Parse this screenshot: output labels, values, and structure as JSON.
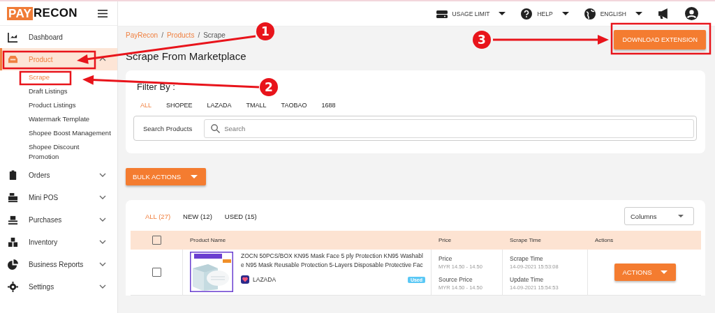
{
  "logo": {
    "part_1": "PAY",
    "part_2": "RECON"
  },
  "sidebar": {
    "items": [
      {
        "label": "Dashboard",
        "selected": false
      },
      {
        "label": "Product",
        "selected": true,
        "expanded": true,
        "children": [
          {
            "label": "Scrape",
            "selected": true
          },
          {
            "label": "Draft Listings",
            "selected": false
          },
          {
            "label": "Product Listings",
            "selected": false
          },
          {
            "label": "Watermark Template",
            "selected": false
          },
          {
            "label": "Shopee Boost Management",
            "selected": false
          },
          {
            "label": "Shopee Discount Promotion",
            "selected": false
          }
        ]
      },
      {
        "label": "Orders",
        "selected": false,
        "expanded": false
      },
      {
        "label": "Mini POS",
        "selected": false,
        "expanded": false
      },
      {
        "label": "Purchases",
        "selected": false,
        "expanded": false
      },
      {
        "label": "Inventory",
        "selected": false,
        "expanded": false
      },
      {
        "label": "Business Reports",
        "selected": false,
        "expanded": false
      },
      {
        "label": "Settings",
        "selected": false,
        "expanded": false
      }
    ]
  },
  "top_bar": {
    "menus": [
      {
        "label": "USAGE LIMIT"
      },
      {
        "label": "HELP"
      },
      {
        "label": "ENGLISH"
      }
    ]
  },
  "breadcrumb": {
    "separator": "/",
    "items": [
      "PayRecon",
      "Products",
      "Scrape"
    ]
  },
  "page_title": "Scrape From Marketplace",
  "download_button": "DOWNLOAD EXTENSION",
  "filter": {
    "title": "Filter By :",
    "tabs": [
      {
        "label": "ALL",
        "selected": true
      },
      {
        "label": "SHOPEE",
        "selected": false
      },
      {
        "label": "LAZADA",
        "selected": false
      },
      {
        "label": "TMALL",
        "selected": false
      },
      {
        "label": "TAOBAO",
        "selected": false
      },
      {
        "label": "1688",
        "selected": false
      }
    ],
    "search_label": "Search Products",
    "placeholder": "Search"
  },
  "bulk_actions": "BULK ACTIONS",
  "table": {
    "tabs": [
      {
        "label": "ALL (27)",
        "selected": true
      },
      {
        "label": "NEW (12)",
        "selected": false
      },
      {
        "label": "USED (15)",
        "selected": false
      }
    ],
    "columns_select": "Columns",
    "select_all": {
      "checked": false
    },
    "columns": [
      "Product Name",
      "Price",
      "Scrape Time",
      "Actions"
    ],
    "rows": [
      {
        "checked": false,
        "name": "ZOCN 50PCS/BOX KN95 Mask Face 5 ply Protection KN95 Washable N95 Mask Reusable Protection 5-Layers Disposable Protective Fac",
        "marketplace": "LAZADA",
        "tag": "Used",
        "price_label": "Price",
        "price": "MYR 14.50 - 14.50",
        "source_price_label": "Source Price",
        "source_price": "MYR 14.50 - 14.50",
        "scrape_time_label": "Scrape Time",
        "scrape_time": "14-09-2021 15:53:08",
        "update_time_label": "Update Time",
        "update_time": "14-09-2021 15:54:53",
        "action": "ACTIONS"
      }
    ]
  },
  "annotations": [
    {
      "number": "1"
    },
    {
      "number": "2"
    },
    {
      "number": "3"
    }
  ]
}
